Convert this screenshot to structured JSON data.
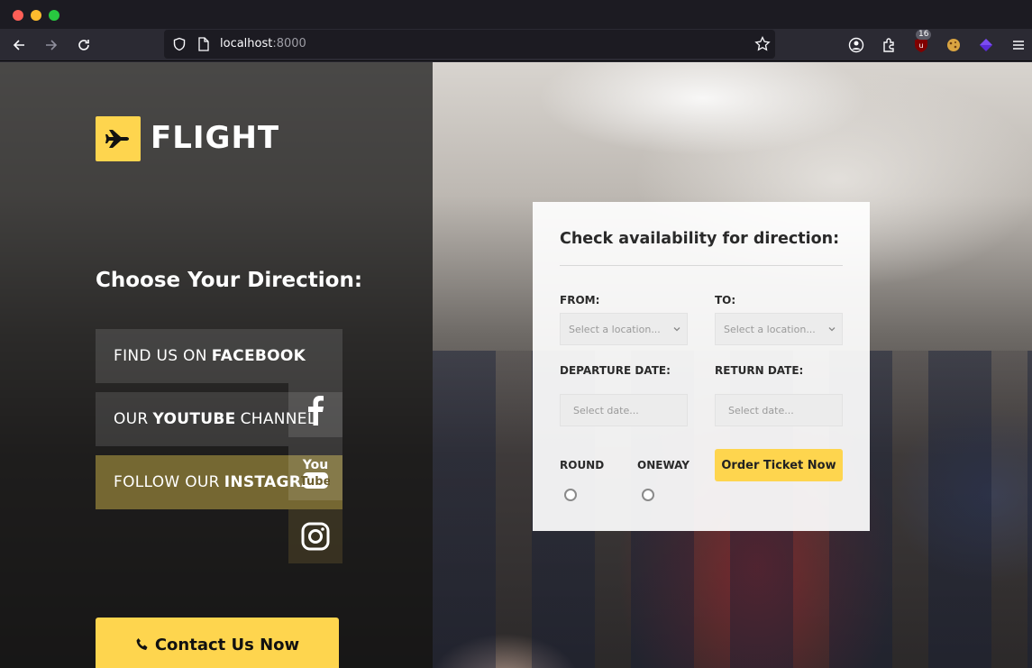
{
  "browser": {
    "url_host": "localhost",
    "url_port": ":8000",
    "extension_badge": "16"
  },
  "brand": {
    "logo_text": "FLIGHT",
    "accent": "#fed54e"
  },
  "left": {
    "heading": "Choose Your Direction:",
    "social": [
      {
        "pre": "FIND US ON",
        "bold": "FACEBOOK",
        "post": ""
      },
      {
        "pre": "OUR",
        "bold": "YOUTUBE",
        "post": "CHANNEL"
      },
      {
        "pre": "FOLLOW OUR",
        "bold": "INSTAGRAM",
        "post": ""
      }
    ],
    "icons": [
      "facebook-icon",
      "youtube-icon",
      "instagram-icon"
    ],
    "contact_label": "Contact Us Now"
  },
  "booking": {
    "title": "Check availability for direction:",
    "from_label": "FROM:",
    "to_label": "TO:",
    "from_placeholder": "Select a location...",
    "to_placeholder": "Select a location...",
    "departure_label": "DEPARTURE DATE:",
    "return_label": "RETURN DATE:",
    "departure_placeholder": "Select date...",
    "return_placeholder": "Select date...",
    "round_label": "ROUND",
    "oneway_label": "ONEWAY",
    "order_label": "Order Ticket Now"
  }
}
